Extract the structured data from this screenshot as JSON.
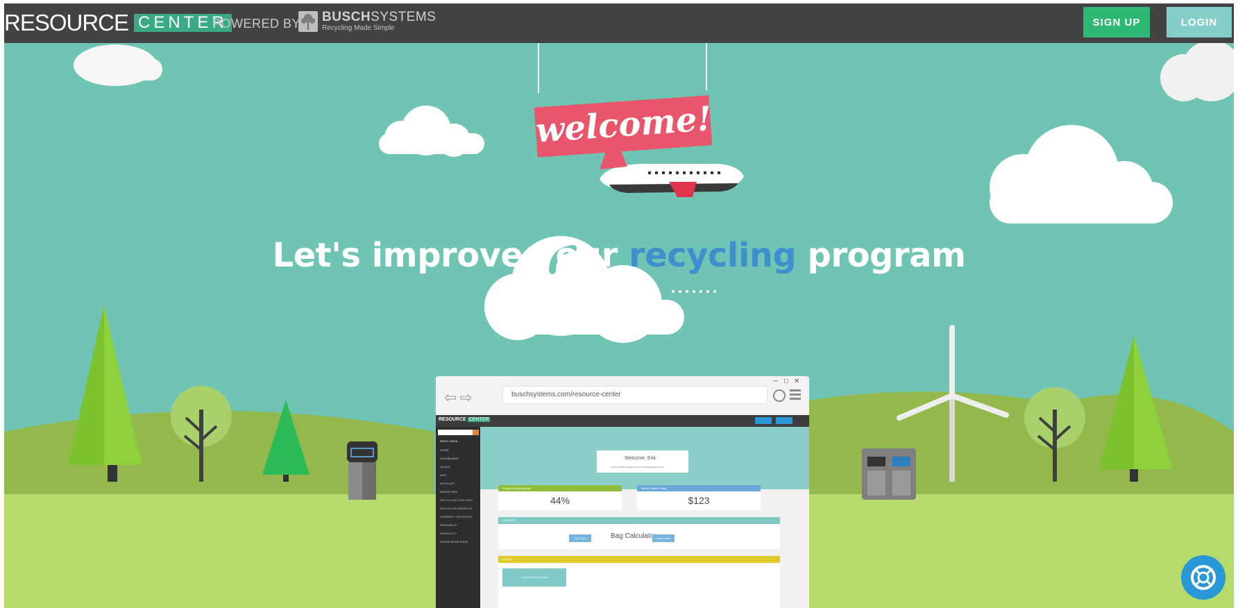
{
  "topbar": {
    "brand_main": "RESOURCE",
    "brand_sub": "CENTER",
    "powered_by": "POWERED BY",
    "partner_name_bold": "BUSCH",
    "partner_name_light": "SYSTEMS",
    "partner_tagline": "Recycling Made Simple",
    "signup_label": "SIGN UP",
    "login_label": "LOGIN"
  },
  "hero": {
    "welcome_sign": "welcome!",
    "headline_pre": "Let's improve your ",
    "headline_accent": "recycling",
    "headline_post": " program"
  },
  "browser": {
    "url": "buschsystems.com/resource-center",
    "inner": {
      "brand_main": "RESOURCE",
      "brand_sub": "CENTER",
      "side_items": [
        "INPUT DATA",
        "HOME",
        "DASHBOARD",
        "GOALS",
        "MAP",
        "ARTICLES",
        "MARKETING",
        "RECYCLING FOR KIDS",
        "RECYCLING MONTH'S",
        "CURRENT STATISTICS",
        "RESEARCH",
        "PRODUCTS",
        "KNOWLEDGE BASE"
      ],
      "welcome_card_title": "Welcome, Erik",
      "welcome_card_sub": "more what's going on in recycling right now",
      "stat1_head": "Today's Recycling Rate",
      "stat1_value": "44%",
      "stat2_head": "Money Saved Today",
      "stat2_value": "$123",
      "updates_head": "UPDATES",
      "try_it_label": "Try It Out",
      "bag_calc_label": "Bag Calculator",
      "learn_more_label": "Learn More",
      "advice_head": "ADVICE",
      "learn_something_label": "Learn Something New"
    }
  },
  "colors": {
    "topbar_bg": "#434343",
    "signup_bg": "#2fb873",
    "login_bg": "#86cec9",
    "hero_bg": "#6fc4b4",
    "accent_blue": "#3e8fd0",
    "sign_red": "#e9566b",
    "help_blue": "#2a98d6"
  },
  "icons": {
    "help": "lifebuoy-icon",
    "partner_logo": "tree-logo-icon"
  }
}
